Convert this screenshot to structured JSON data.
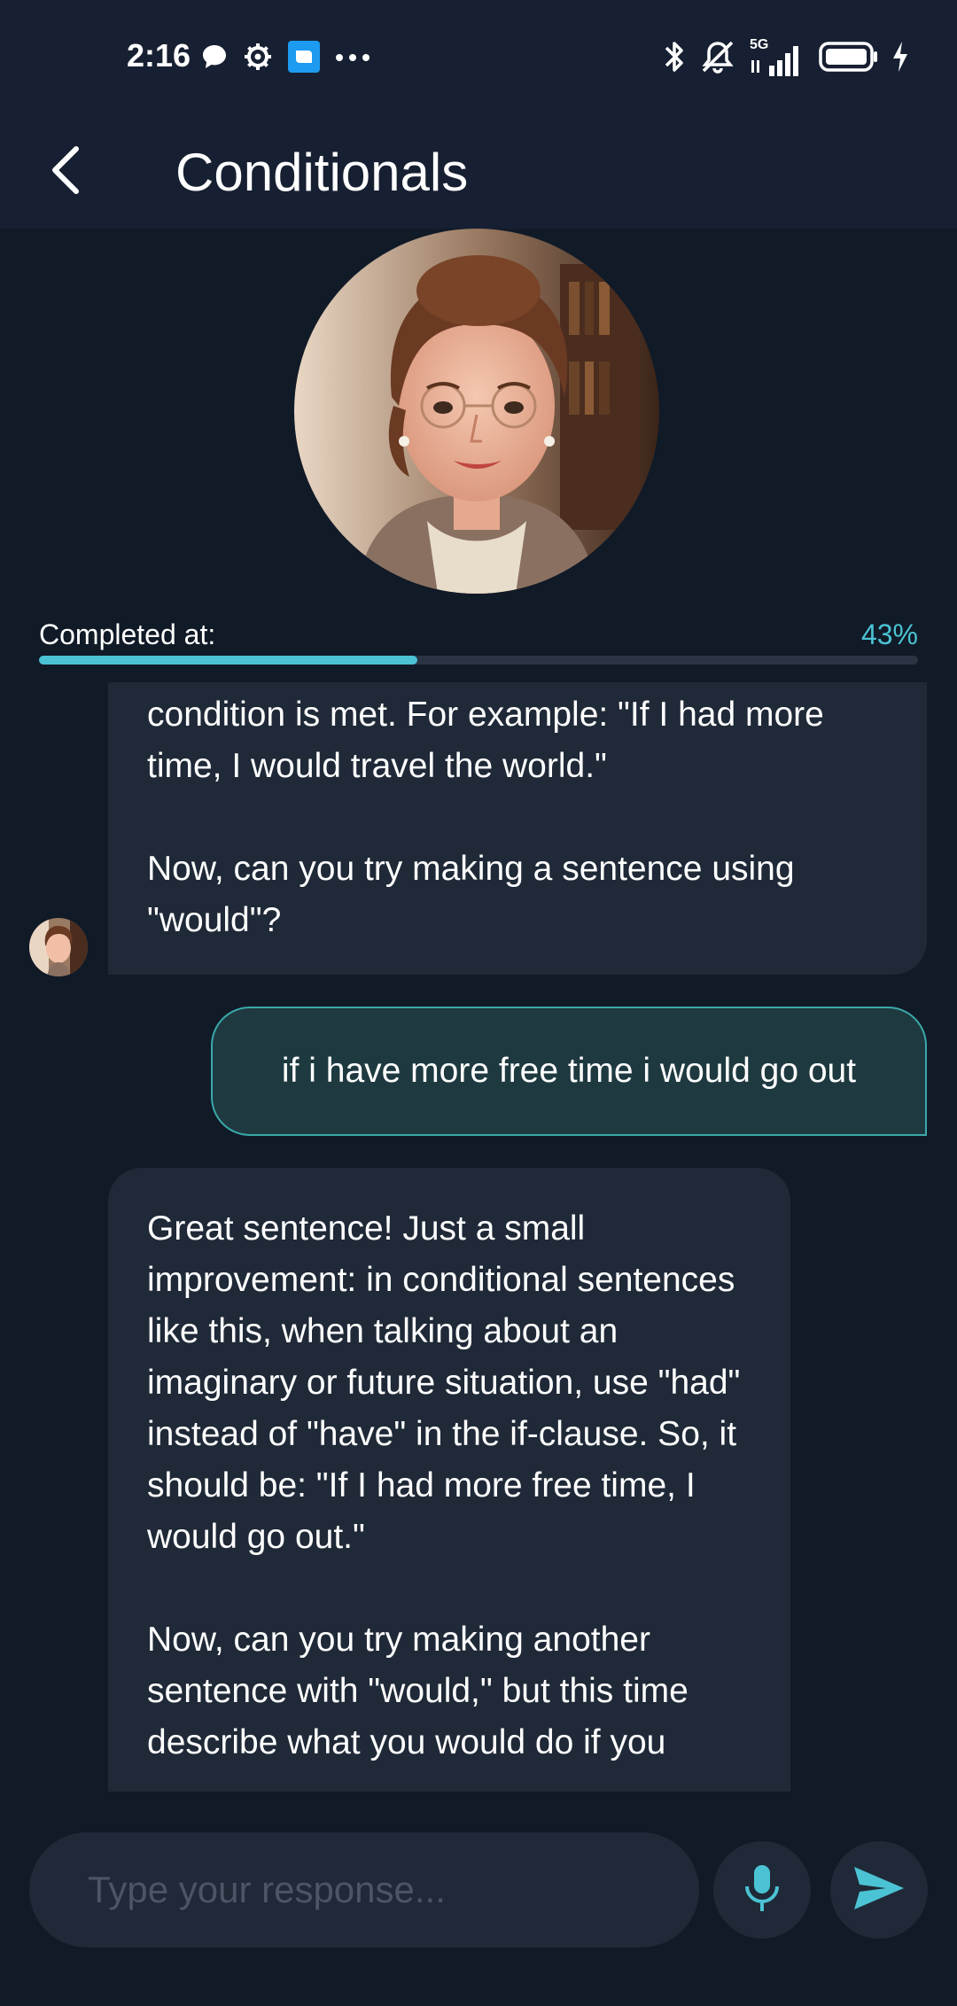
{
  "status_bar": {
    "time": "2:16",
    "network": "5G",
    "icons_left": [
      "chat-bubble-icon",
      "gear-icon",
      "app-square-icon",
      "more-dots-icon"
    ],
    "icons_right": [
      "bluetooth-icon",
      "bell-off-icon",
      "signal-icon",
      "battery-icon",
      "charging-icon"
    ]
  },
  "app_bar": {
    "title": "Conditionals",
    "back_icon": "chevron-left-icon"
  },
  "progress": {
    "label": "Completed at:",
    "value_text": "43%",
    "fraction": 0.43
  },
  "messages": [
    {
      "role": "assistant",
      "text": "condition is met. For example: \"If I had more time, I would travel the world.\"\n\nNow, can you try making a sentence using \"would\"?"
    },
    {
      "role": "user",
      "text": "if i have more free time i would go out"
    },
    {
      "role": "assistant",
      "text": "Great sentence! Just a small improvement: in conditional sentences like this, when talking about an imaginary or future situation, use \"had\" instead of \"have\" in the if-clause. So, it should be: \"If I had more free time, I would go out.\"\n\nNow, can you try making another sentence with \"would,\" but this time describe what you would do if you"
    }
  ],
  "input": {
    "placeholder": "Type your response..."
  },
  "colors": {
    "background": "#111a27",
    "header": "#172032",
    "bubble": "#1f2937",
    "user_bubble": "#1e3a40",
    "accent": "#4bc3d4"
  }
}
